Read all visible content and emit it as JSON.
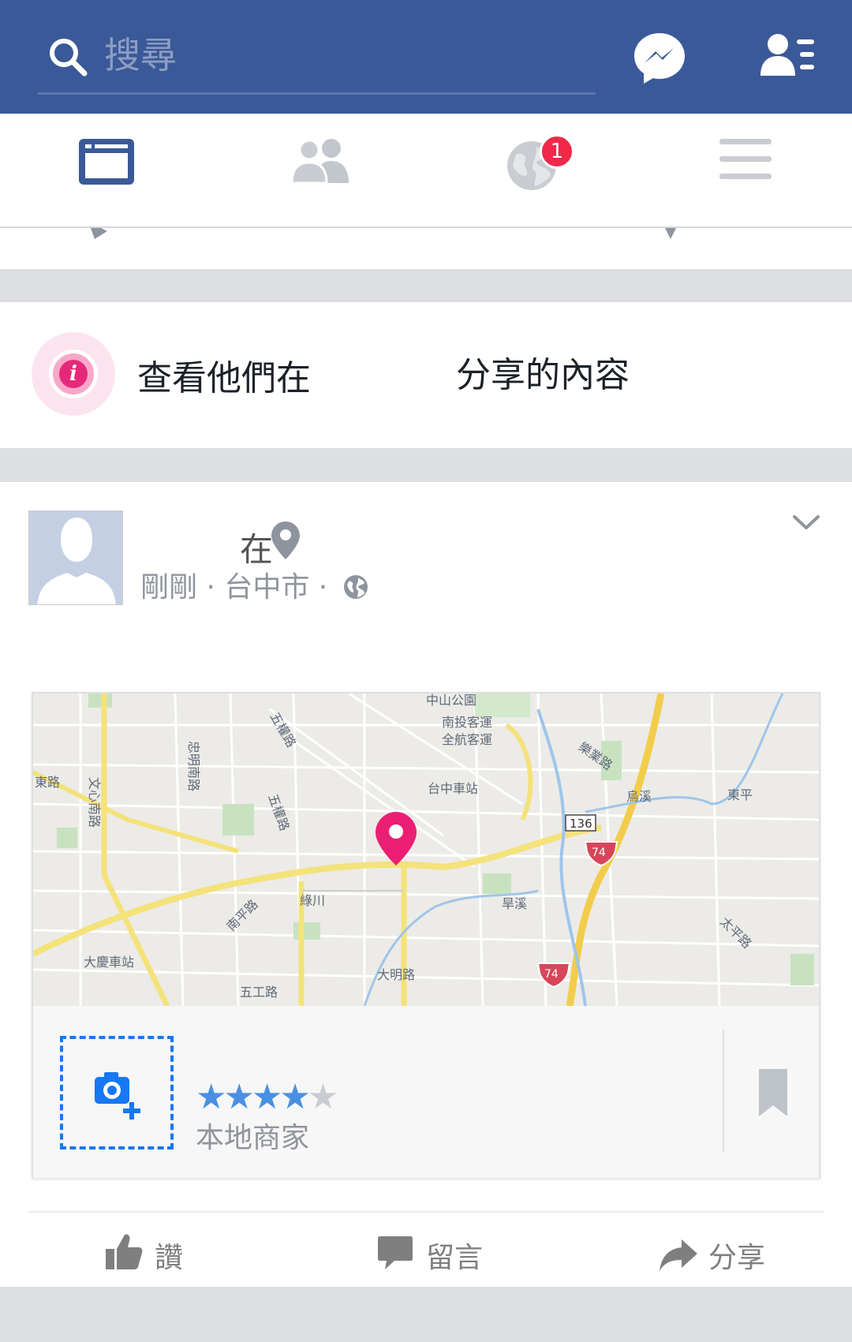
{
  "search": {
    "placeholder": "搜尋"
  },
  "badge": {
    "count": "1"
  },
  "info_banner": {
    "text_start": "查看他們在",
    "text_end": "分享的內容"
  },
  "post": {
    "in_label": "在",
    "meta": "剛剛 · 台中市 ·",
    "place": {
      "rating": 4,
      "rating_max": 5,
      "category": "本地商家"
    },
    "map_labels": {
      "park": "中山公園",
      "bus1": "南投客運",
      "bus2": "全航客運",
      "road_lerye": "樂業路",
      "station": "台中車站",
      "road_east": "東平",
      "road_wuquan_top": "五權路",
      "road_zhongming": "忠明南路",
      "road_wenxin": "文心南路",
      "road_left": "東路",
      "road_wuquan": "五權路",
      "route136": "136",
      "route74a": "74",
      "route74b": "74",
      "stream": "綠川",
      "road_nanping": "南平路",
      "creek": "旱溪",
      "river": "烏溪",
      "daqing": "大慶車站",
      "road_taiping": "太平路",
      "road_daming": "大明路",
      "road_bottom": "五工路"
    }
  },
  "actions": {
    "like": "讚",
    "comment": "留言",
    "share": "分享"
  },
  "colors": {
    "brand": "#3b5998",
    "pin": "#ea1f73",
    "star": "#4a90e2"
  }
}
